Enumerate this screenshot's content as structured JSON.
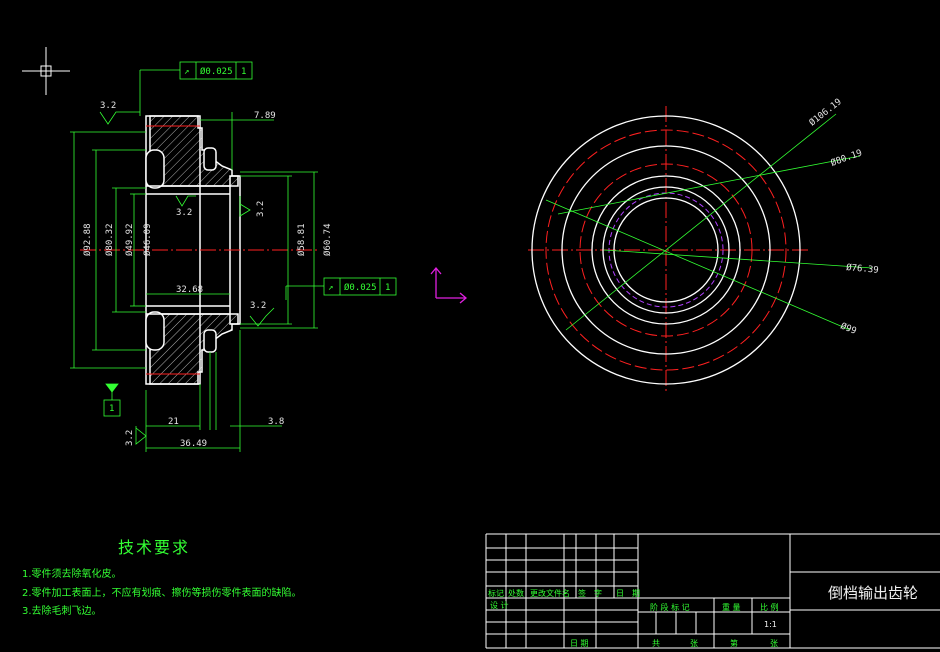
{
  "drawing": {
    "part_name": "倒档输出齿轮",
    "tech_requirements": {
      "title": "技术要求",
      "items": [
        "1.零件须去除氧化皮。",
        "2.零件加工表面上，不应有划痕、擦伤等损伤零件表面的缺陷。",
        "3.去除毛刺飞边。"
      ]
    },
    "dimensions": {
      "top_right": "7.89",
      "runout_top": "Ø0.025",
      "runout_mid": "Ø0.025",
      "datum": "1",
      "rough_top": "3.2",
      "rough_mid": "3.2",
      "rough_right": "3.2",
      "rough_lower": "3.2",
      "rough_left": "3.2",
      "d_92": "Ø92.88",
      "d_80": "Ø80.32",
      "d_49": "Ø49.92",
      "d_46": "Ø46.09",
      "d_58": "Ø58.81",
      "d_60": "Ø60.74",
      "len_32": "32.68",
      "len_21": "21",
      "len_3": "3.8",
      "len_36": "36.49"
    },
    "circle_labels": {
      "d_106": "Ø106.19",
      "d_80": "Ø80.19",
      "d_76": "Ø76.39",
      "d_99": "Ø99"
    },
    "title_block": {
      "row_labels": [
        "标记",
        "处数",
        "更改文件名",
        "签　字",
        "日　期"
      ],
      "design_label": "设 计",
      "date_label": "日 期",
      "stage_labels": [
        "阶 段 标 记",
        "重 量",
        "比 例"
      ],
      "scale": "1:1",
      "sheet_labels": [
        "共",
        "张",
        "第",
        "张"
      ]
    }
  },
  "colors": {
    "background": "#000000",
    "geometry": "#ffffff",
    "annotation": "#33ff33",
    "centerline": "#ff2020",
    "hatch": "#ffffff",
    "ucs": "#e020e0"
  }
}
